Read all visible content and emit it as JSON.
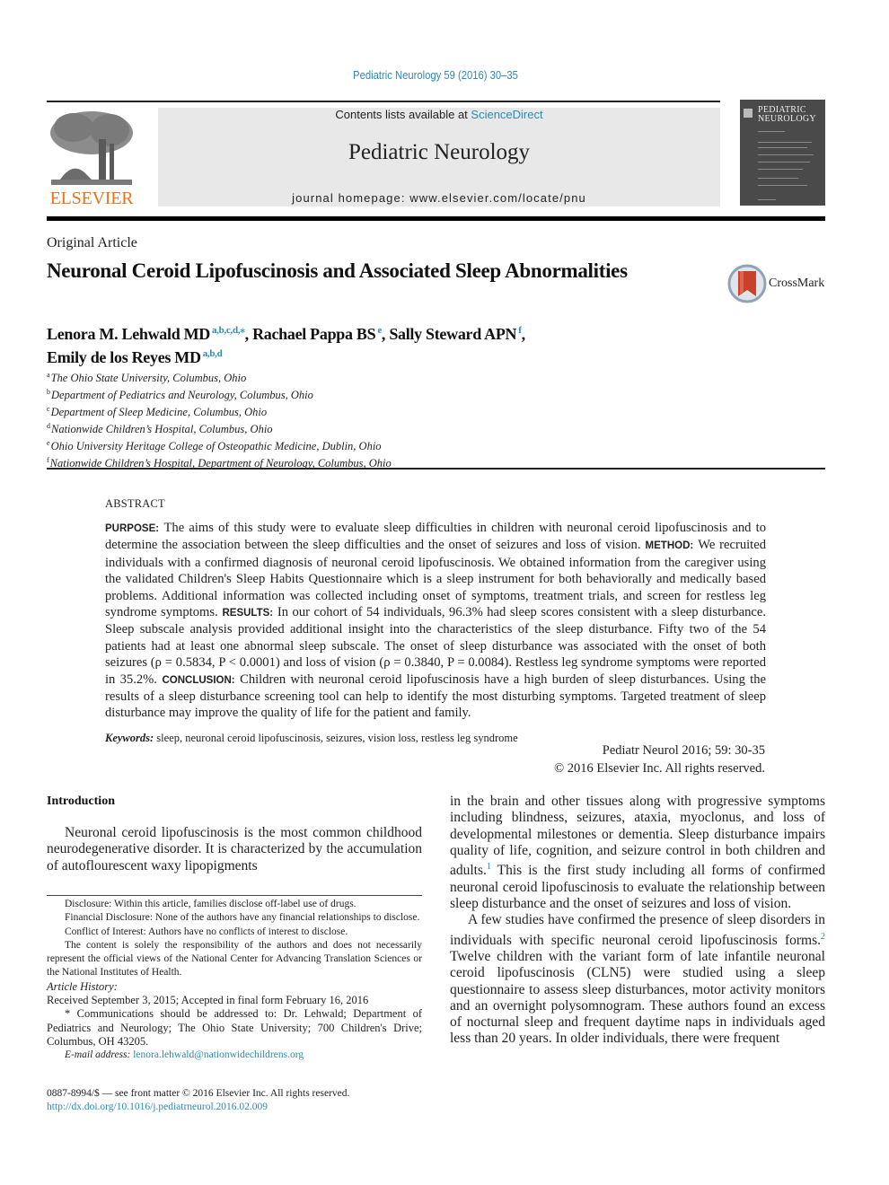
{
  "header": {
    "journal_reference": "Pediatric Neurology 59 (2016) 30–35",
    "contents_prefix": "Contents lists available at ",
    "contents_link": "ScienceDirect",
    "journal_title": "Pediatric Neurology",
    "homepage": "journal homepage: www.elsevier.com/locate/pnu",
    "publisher_logo_text": "ELSEVIER",
    "cover_title_line1": "PEDIATRIC",
    "cover_title_line2": "NEUROLOGY"
  },
  "article": {
    "type": "Original Article",
    "title": "Neuronal Ceroid Lipofuscinosis and Associated Sleep Abnormalities",
    "crossmark_label": "CrossMark",
    "authors": [
      {
        "name": "Lenora M. Lehwald MD",
        "affil": "a,b,c,d,⁎",
        "sep": ", "
      },
      {
        "name": "Rachael Pappa BS",
        "affil": "e",
        "sep": ", "
      },
      {
        "name": "Sally Steward APN",
        "affil": "f",
        "sep": ","
      },
      {
        "name": "Emily de los Reyes MD",
        "affil": "a,b,d",
        "sep": ""
      }
    ],
    "affiliations": [
      {
        "key": "a",
        "text": "The Ohio State University, Columbus, Ohio"
      },
      {
        "key": "b",
        "text": "Department of Pediatrics and Neurology, Columbus, Ohio"
      },
      {
        "key": "c",
        "text": "Department of Sleep Medicine, Columbus, Ohio"
      },
      {
        "key": "d",
        "text": "Nationwide Children’s Hospital, Columbus, Ohio"
      },
      {
        "key": "e",
        "text": "Ohio University Heritage College of Osteopathic Medicine, Dublin, Ohio"
      },
      {
        "key": "f",
        "text": "Nationwide Children’s Hospital, Department of Neurology, Columbus, Ohio"
      }
    ]
  },
  "abstract": {
    "heading": "ABSTRACT",
    "purpose_label": "PURPOSE:",
    "purpose": "The aims of this study were to evaluate sleep difficulties in children with neuronal ceroid lipofuscinosis and to determine the association between the sleep difficulties and the onset of seizures and loss of vision.",
    "method_label": "METHOD:",
    "method": "We recruited individuals with a confirmed diagnosis of neuronal ceroid lipofuscinosis. We obtained information from the caregiver using the validated Children's Sleep Habits Questionnaire which is a sleep in­strument for both behaviorally and medically based problems. Additional information was collected including onset of symptoms, treatment trials, and screen for restless leg syndrome symptoms.",
    "results_label": "RESULTS:",
    "results": "In our cohort of 54 individuals, 96.3% had sleep scores consistent with a sleep disturbance. Sleep subscale analysis provided additional insight into the characteristics of the sleep disturbance. Fifty two of the 54 patients had at least one abnormal sleep subscale. The onset of sleep disturbance was associated with the onset of both seizures (ρ = 0.5834, P < 0.0001) and loss of vision (ρ = 0.3840, P = 0.0084). Restless leg syndrome symptoms were reported in 35.2%.",
    "conclusion_label": "CONCLUSION:",
    "conclusion": "Children with neuronal ceroid lipofuscinosis have a high burden of sleep disturbances. Using the results of a sleep disturbance screening tool can help to identify the most disturbing symptoms. Targeted treatment of sleep disturbance may improve the quality of life for the patient and family.",
    "keywords_label": "Keywords:",
    "keywords": "sleep, neuronal ceroid lipofuscinosis, seizures, vision loss, restless leg syndrome",
    "citation": "Pediatr Neurol 2016; 59: 30-35",
    "copyright": "© 2016 Elsevier Inc. All rights reserved."
  },
  "body": {
    "intro_heading": "Introduction",
    "left_para": "Neuronal ceroid lipofuscinosis is the most common childhood neurodegenerative disorder. It is characterized by the accumulation of autoflourescent waxy lipopigments",
    "right_para1_a": "in the brain and other tissues along with progressive symptoms including blindness, seizures, ataxia, myoclonus, and loss of developmental milestones or dementia. Sleep disturbance impairs quality of life, cognition, and seizure control in both children and adults.",
    "right_para1_ref": "1",
    "right_para1_b": " This is the first study including all forms of confirmed neuronal ceroid lip­ofuscinosis to evaluate the relationship between sleep disturbance and the onset of seizures and loss of vision.",
    "right_para2_a": "A few studies have confirmed the presence of sleep dis­orders in individuals with specific neuronal ceroid lip­ofuscinosis forms.",
    "right_para2_ref": "2",
    "right_para2_b": " Twelve children with the variant form of late infantile neuronal ceroid lipofuscinosis (CLN5) were studied using a sleep questionnaire to assess sleep distur­bances, motor activity monitors and an overnight poly­somnogram. These authors found an excess of nocturnal sleep and frequent daytime naps in individuals aged less than 20 years. In older individuals, there were frequent"
  },
  "footnotes": {
    "disclosure": "Disclosure: Within this article, families disclose off-label use of drugs.",
    "financial": "Financial Disclosure: None of the authors have any financial relationships to disclose.",
    "conflict": "Conflict of Interest: Authors have no conflicts of interest to disclose.",
    "content": "The content is solely the responsibility of the authors and does not necessarily represent the official views of the National Center for Advancing Translation Sci­ences or the National Institutes of Health.",
    "history_label": "Article History:",
    "history": "Received September 3, 2015; Accepted in final form February 16, 2016",
    "correspondence": "* Communications should be addressed to: Dr. Lehwald; Department of Pediatrics and Neurology; The Ohio State University; 700 Children's Drive; Columbus, OH 43205.",
    "email_label": "E-mail address:",
    "email": "lenora.lehwald@nationwidechildrens.org",
    "issn": "0887-8994/$ — see front matter © 2016 Elsevier Inc. All rights reserved.",
    "doi": "http://dx.doi.org/10.1016/j.pediatrneurol.2016.02.009"
  }
}
